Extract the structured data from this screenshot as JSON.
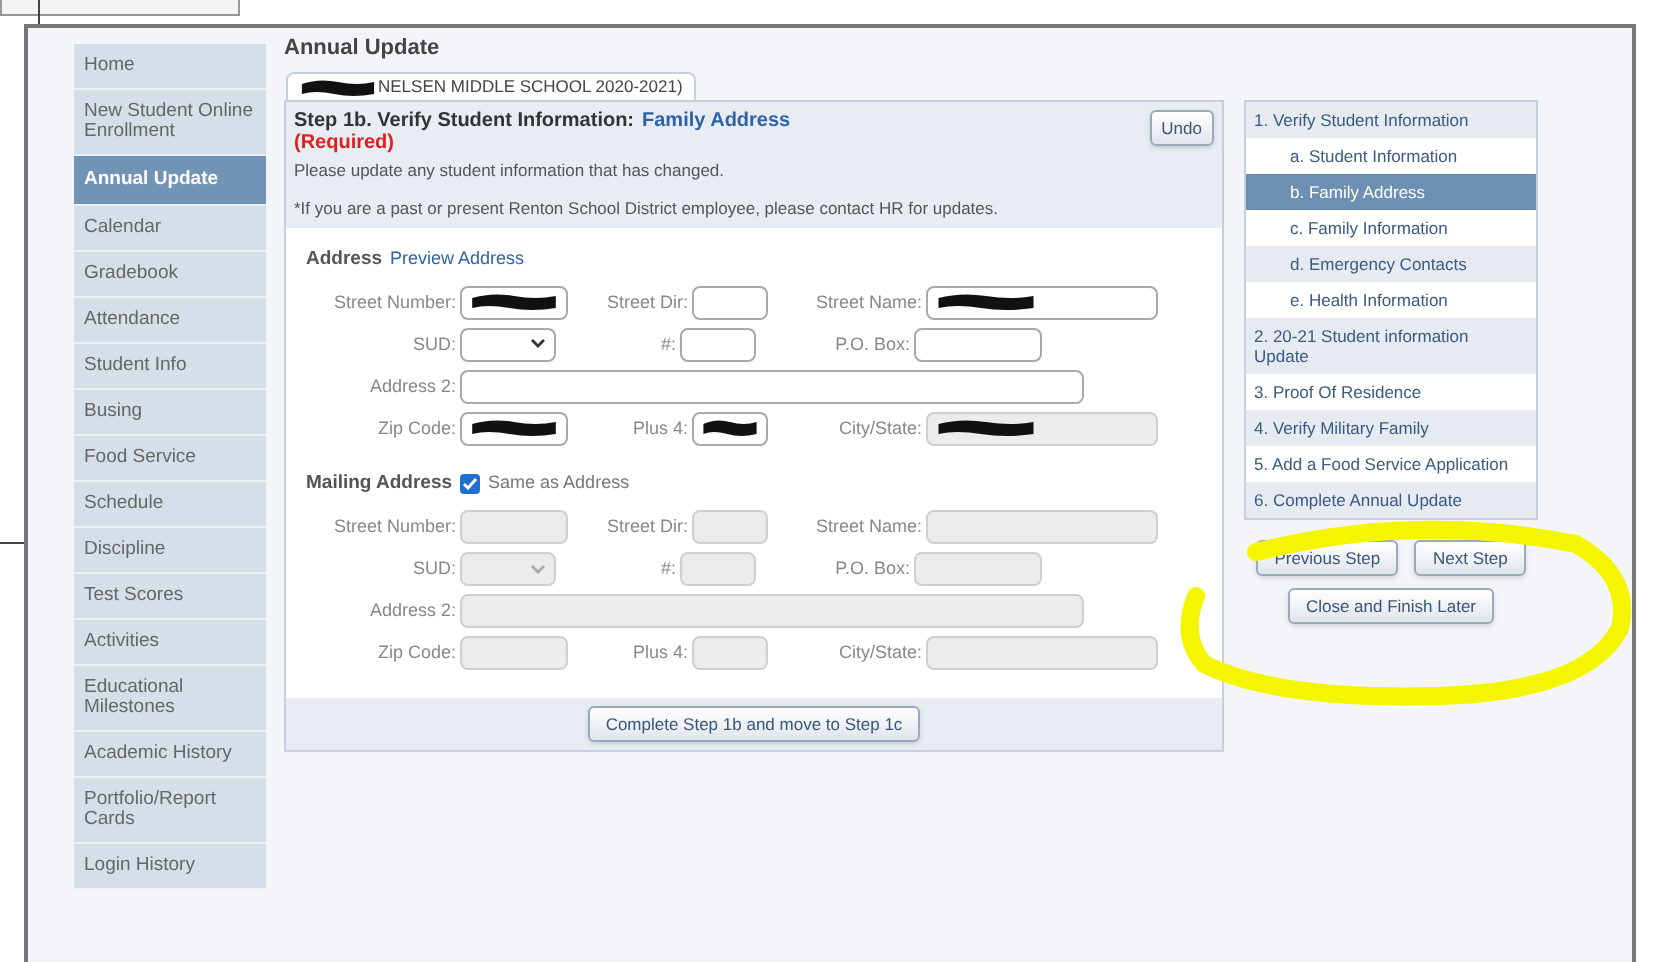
{
  "page_title": "Annual Update",
  "sidebar": {
    "items": [
      {
        "label": "Home",
        "selected": false
      },
      {
        "label": "New Student Online Enrollment",
        "selected": false
      },
      {
        "label": "Annual Update",
        "selected": true
      },
      {
        "label": "Calendar",
        "selected": false
      },
      {
        "label": "Gradebook",
        "selected": false
      },
      {
        "label": "Attendance",
        "selected": false
      },
      {
        "label": "Student Info",
        "selected": false
      },
      {
        "label": "Busing",
        "selected": false
      },
      {
        "label": "Food Service",
        "selected": false
      },
      {
        "label": "Schedule",
        "selected": false
      },
      {
        "label": "Discipline",
        "selected": false
      },
      {
        "label": "Test Scores",
        "selected": false
      },
      {
        "label": "Activities",
        "selected": false
      },
      {
        "label": "Educational Milestones",
        "selected": false
      },
      {
        "label": "Academic History",
        "selected": false
      },
      {
        "label": "Portfolio/Report Cards",
        "selected": false
      },
      {
        "label": "Login History",
        "selected": false
      }
    ]
  },
  "student_tab": {
    "label": "NELSEN MIDDLE SCHOOL 2020-2021)",
    "redacted": true
  },
  "step": {
    "title": "Step 1b. Verify Student Information:",
    "subtitle": "Family Address",
    "required": "(Required)",
    "undo": "Undo",
    "note": "Please update any student information that has changed.",
    "hr_note": "*If you are a past or present Renton School District employee, please contact HR for updates."
  },
  "address": {
    "heading": "Address",
    "link": "Preview Address",
    "disabled": false,
    "rows": [
      [
        {
          "label": "Street Number:",
          "kind": "text",
          "redacted": true
        },
        {
          "label": "Street Dir:",
          "kind": "text",
          "redacted": false
        },
        {
          "label": "Street Name:",
          "kind": "text",
          "redacted": true
        }
      ],
      [
        {
          "label": "SUD:",
          "kind": "select",
          "redacted": false
        },
        {
          "label": "#:",
          "kind": "text",
          "redacted": false
        },
        {
          "label": "P.O. Box:",
          "kind": "text",
          "redacted": false
        }
      ],
      [
        {
          "label": "Address 2:",
          "kind": "wide",
          "redacted": false
        }
      ],
      [
        {
          "label": "Zip Code:",
          "kind": "text",
          "redacted": true
        },
        {
          "label": "Plus 4:",
          "kind": "text",
          "redacted": true
        },
        {
          "label": "City/State:",
          "kind": "readonly",
          "redacted": true
        }
      ]
    ]
  },
  "mailing": {
    "heading": "Mailing Address",
    "same_label": "Same as Address",
    "checked": true,
    "disabled": true,
    "rows": [
      [
        {
          "label": "Street Number:",
          "kind": "text",
          "redacted": false
        },
        {
          "label": "Street Dir:",
          "kind": "text",
          "redacted": false
        },
        {
          "label": "Street Name:",
          "kind": "text",
          "redacted": false
        }
      ],
      [
        {
          "label": "SUD:",
          "kind": "select",
          "redacted": false
        },
        {
          "label": "#:",
          "kind": "text",
          "redacted": false
        },
        {
          "label": "P.O. Box:",
          "kind": "text",
          "redacted": false
        }
      ],
      [
        {
          "label": "Address 2:",
          "kind": "wide",
          "redacted": false
        }
      ],
      [
        {
          "label": "Zip Code:",
          "kind": "text",
          "redacted": false
        },
        {
          "label": "Plus 4:",
          "kind": "text",
          "redacted": false
        },
        {
          "label": "City/State:",
          "kind": "text",
          "redacted": false
        }
      ]
    ]
  },
  "complete_button": "Complete Step 1b and move to Step 1c",
  "steps": [
    {
      "label": "1. Verify Student Information",
      "selected": false,
      "children": [
        {
          "label": "a. Student Information",
          "selected": false
        },
        {
          "label": "b. Family Address",
          "selected": true
        },
        {
          "label": "c. Family Information",
          "selected": false
        },
        {
          "label": "d. Emergency Contacts",
          "selected": false
        },
        {
          "label": "e. Health Information",
          "selected": false
        }
      ]
    },
    {
      "label": "2. 20-21 Student information Update",
      "selected": false
    },
    {
      "label": "3. Proof Of Residence",
      "selected": false
    },
    {
      "label": "4. Verify Military Family",
      "selected": false
    },
    {
      "label": "5. Add a Food Service Application",
      "selected": false
    },
    {
      "label": "6. Complete Annual Update",
      "selected": false
    }
  ],
  "nav_buttons": [
    "Previous Step",
    "Next Step"
  ],
  "close_button": "Close and Finish Later"
}
